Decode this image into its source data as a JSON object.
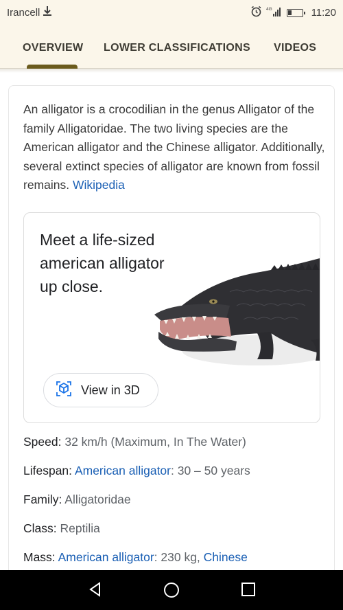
{
  "status_bar": {
    "carrier": "Irancell",
    "network": "4G",
    "time": "11:20"
  },
  "tabs": [
    {
      "label": "OVERVIEW",
      "active": true
    },
    {
      "label": "LOWER CLASSIFICATIONS",
      "active": false
    },
    {
      "label": "VIDEOS",
      "active": false
    }
  ],
  "description": {
    "text": "An alligator is a crocodilian in the genus Alligator of the family Alligatoridae. The two living species are the American alligator and the Chinese alligator. Additionally, several extinct species of alligator are known from fossil remains.",
    "source_link": "Wikipedia"
  },
  "view_3d": {
    "title": "Meet a life-sized american alligator up close.",
    "button_label": "View in 3D"
  },
  "facts": [
    {
      "key": "Speed:",
      "value": "32 km/h (Maximum, In The Water)"
    },
    {
      "key": "Lifespan:",
      "link": "American alligator",
      "value": ": 30 – 50 years"
    },
    {
      "key": "Family:",
      "value": "Alligatoridae"
    },
    {
      "key": "Class:",
      "value": "Reptilia"
    },
    {
      "key": "Mass:",
      "link": "American alligator",
      "value": ": 230 kg, ",
      "link2": "Chinese"
    }
  ],
  "colors": {
    "header_bg": "#fbf6ea",
    "tab_indicator": "#6b5b1d",
    "link": "#1a5fb4",
    "view3d_icon": "#1a73e8"
  },
  "icons": {
    "download": "download-icon",
    "alarm": "alarm-icon",
    "signal": "signal-icon",
    "battery": "battery-icon",
    "cube3d": "cube-3d-icon",
    "nav_back": "back-triangle-icon",
    "nav_home": "home-circle-icon",
    "nav_recents": "recents-square-icon"
  }
}
